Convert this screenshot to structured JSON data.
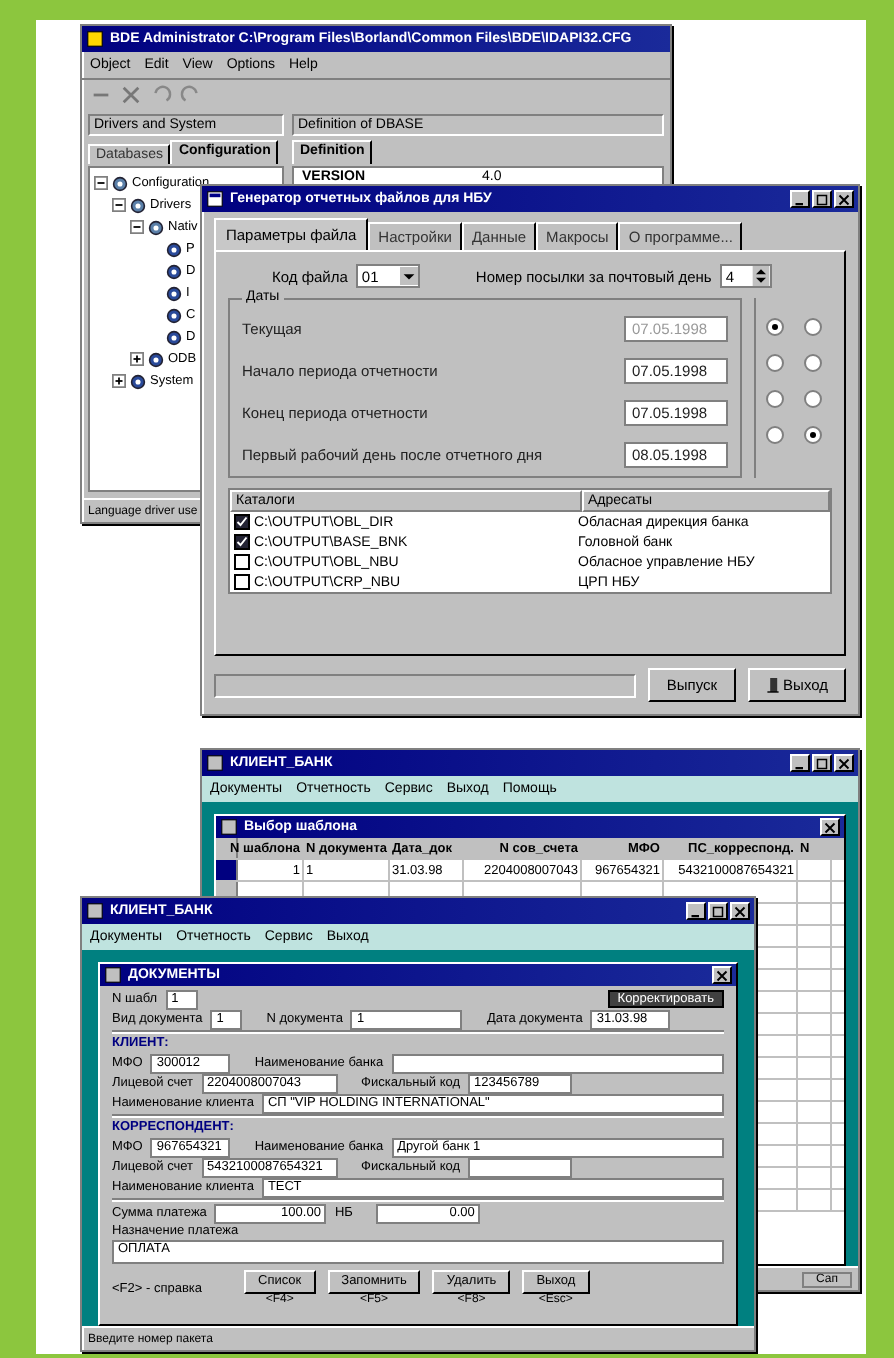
{
  "bde_window": {
    "title": "BDE Administrator  C:\\Program Files\\Borland\\Common Files\\BDE\\IDAPI32.CFG",
    "menu": [
      "Object",
      "Edit",
      "View",
      "Options",
      "Help"
    ],
    "left_header": "Drivers and System",
    "right_header": "Definition of DBASE",
    "left_tabs": [
      {
        "label": "Databases",
        "selected": false
      },
      {
        "label": "Configuration",
        "selected": true
      }
    ],
    "right_tabs": [
      {
        "label": "Definition",
        "selected": true
      }
    ],
    "tree": [
      {
        "label": "Configuration",
        "expanded": true,
        "children": [
          {
            "label": "Drivers",
            "expanded": true,
            "children": [
              {
                "label": "Nativ",
                "expanded": true,
                "children": [
                  {
                    "label": "P"
                  },
                  {
                    "label": "D"
                  },
                  {
                    "label": "I"
                  },
                  {
                    "label": "C"
                  },
                  {
                    "label": "D"
                  }
                ]
              },
              {
                "label": "ODB",
                "expanded": false
              }
            ]
          },
          {
            "label": "System",
            "expanded": false
          }
        ]
      }
    ],
    "definition_rows": [
      {
        "name": "VERSION",
        "value": "4.0"
      }
    ],
    "status": "Language driver use"
  },
  "generator_dialog": {
    "title": "Генератор отчетных файлов для НБУ",
    "tabs": [
      {
        "label": "Параметры файла",
        "selected": true
      },
      {
        "label": "Настройки",
        "selected": false
      },
      {
        "label": "Данные",
        "selected": false
      },
      {
        "label": "Макросы",
        "selected": false
      },
      {
        "label": "О программе...",
        "selected": false
      }
    ],
    "file_code": {
      "label": "Код файла",
      "value": "01"
    },
    "packet_number": {
      "label": "Номер посылки за почтовый день",
      "value": "4"
    },
    "dates_group": "Даты",
    "dates": [
      {
        "label": "Текущая",
        "value": "07.05.1998",
        "disabled": true,
        "radios": [
          {
            "selected": true
          },
          {
            "selected": false
          }
        ]
      },
      {
        "label": "Начало периода отчетности",
        "value": "07.05.1998",
        "disabled": false,
        "radios": [
          {
            "selected": false
          },
          {
            "selected": false
          }
        ]
      },
      {
        "label": "Конец периода отчетности",
        "value": "07.05.1998",
        "disabled": false,
        "radios": [
          {
            "selected": false
          },
          {
            "selected": false
          }
        ]
      },
      {
        "label": "Первый рабочий день после отчетного дня",
        "value": "08.05.1998",
        "disabled": false,
        "radios": [
          {
            "selected": false
          },
          {
            "selected": true
          }
        ]
      }
    ],
    "list_columns": [
      "Каталоги",
      "Адресаты"
    ],
    "list_rows": [
      {
        "path": "C:\\OUTPUT\\OBL_DIR",
        "recipient": "Обласная дирекция банка",
        "checked": true
      },
      {
        "path": "C:\\OUTPUT\\BASE_BNK",
        "recipient": "Головной банк",
        "checked": true
      },
      {
        "path": "C:\\OUTPUT\\OBL_NBU",
        "recipient": "Обласное управление НБУ",
        "checked": false
      },
      {
        "path": "C:\\OUTPUT\\CRP_NBU",
        "recipient": "ЦРП НБУ",
        "checked": false
      }
    ],
    "buttons": [
      "Выпуск",
      "Выход"
    ]
  },
  "client_bank_back": {
    "title": "КЛИЕНТ_БАНК",
    "menu": [
      "Документы",
      "Отчетность",
      "Сервис",
      "Выход",
      "Помощь"
    ],
    "template_window": {
      "title": "Выбор шаблона",
      "columns": [
        "N шаблона",
        "N документа",
        "Дата_док",
        "N сов_счета",
        "МФО",
        "ПС_корреспонд.",
        "N"
      ],
      "rows": [
        [
          "1",
          "1",
          "31.03.98",
          "2204008007043",
          "967654321",
          "5432100087654321",
          ""
        ]
      ]
    },
    "status": "Сап"
  },
  "client_bank_front": {
    "title": "КЛИЕНТ_БАНК",
    "menu": [
      "Документы",
      "Отчетность",
      "Сервис",
      "Выход"
    ],
    "documents": {
      "title": "ДОКУМЕНТЫ",
      "template_no": {
        "label": "N шабл",
        "value": "1"
      },
      "edit_button": "Корректировать",
      "doc_type": {
        "label": "Вид документа",
        "value": "1"
      },
      "doc_no": {
        "label": "N документа",
        "value": "1"
      },
      "doc_date": {
        "label": "Дата документа",
        "value": "31.03.98"
      },
      "client_section": "КЛИЕНТ:",
      "client": {
        "mfo": {
          "label": "МФО",
          "value": "300012"
        },
        "bank": {
          "label": "Наименование банка"
        },
        "account": {
          "label": "Лицевой счет",
          "value": "2204008007043"
        },
        "fiscal": {
          "label": "Фискальный код",
          "value": "123456789"
        },
        "name": {
          "label": "Наименование клиента",
          "value": "СП \"VIP HOLDING INTERNATIONAL\""
        }
      },
      "corr_section": "КОРРЕСПОНДЕНТ:",
      "corr": {
        "mfo": {
          "label": "МФО",
          "value": "967654321"
        },
        "bank": {
          "label": "Наименование банка",
          "value": "Другой банк 1"
        },
        "account": {
          "label": "Лицевой счет",
          "value": "5432100087654321"
        },
        "fiscal": {
          "label": "Фискальный код"
        },
        "name": {
          "label": "Наименование клиента",
          "value": "ТЕСТ"
        }
      },
      "amount": {
        "label": "Сумма платежа",
        "value": "100.00",
        "unit": "НБ",
        "extra": "0.00"
      },
      "purpose": {
        "label": "Назначение платежа",
        "value": "ОПЛАТА"
      },
      "help_hint": "<F2> - справка",
      "buttons": [
        {
          "label": "Список",
          "key": "<F4>"
        },
        {
          "label": "Запомнить",
          "key": "<F5>"
        },
        {
          "label": "Удалить",
          "key": "<F8>"
        },
        {
          "label": "Выход",
          "key": "<Esc>"
        }
      ]
    },
    "status": "Введите номер пакета"
  }
}
